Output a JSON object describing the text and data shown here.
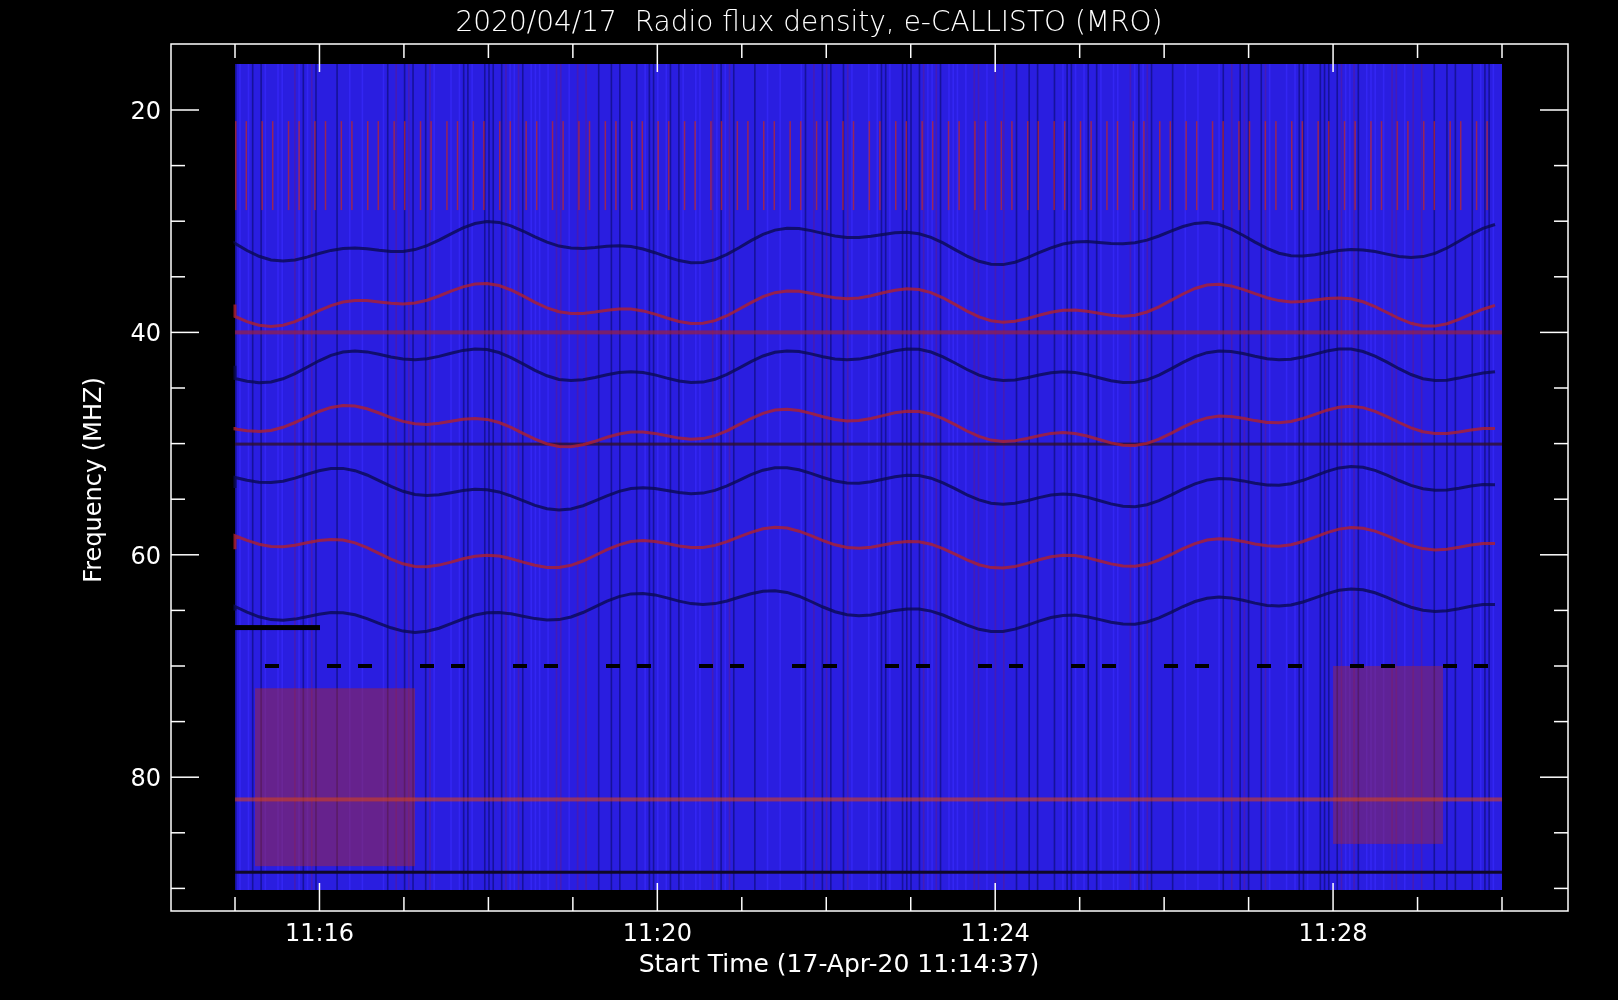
{
  "title": "2020/04/17  Radio flux density, e-CALLISTO (MRO)",
  "y_axis": {
    "label": "Frequency (MHZ)",
    "ticks": [
      "20",
      "40",
      "60",
      "80"
    ]
  },
  "x_axis": {
    "label": "Start Time (17-Apr-20 11:14:37)",
    "ticks": [
      "11:16",
      "11:20",
      "11:24",
      "11:28"
    ]
  }
}
